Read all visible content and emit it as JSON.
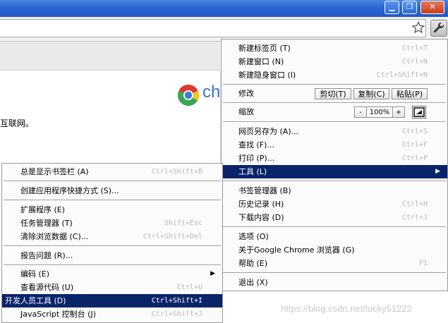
{
  "window": {
    "minimize_glyph": "▁",
    "restore_glyph": "❐",
    "close_glyph": "✕"
  },
  "toolbar": {
    "star_icon": "star-icon",
    "wrench_icon": "wrench-icon"
  },
  "page": {
    "logo_text": "ch",
    "text": "互联网。"
  },
  "main_menu": {
    "new_tab": {
      "label": "新建标签页 (T)",
      "shortcut": "Ctrl+T"
    },
    "new_window": {
      "label": "新建窗口 (N)",
      "shortcut": "Ctrl+N"
    },
    "new_incognito": {
      "label": "新建隐身窗口 (I)",
      "shortcut": "Ctrl+Shift+N"
    },
    "edit_label": "修改",
    "cut": "剪切(T)",
    "copy": "复制(C)",
    "paste": "粘贴(P)",
    "zoom_label": "缩放",
    "zoom_out": "-",
    "zoom_value": "100%",
    "zoom_in": "+",
    "save_as": {
      "label": "网页另存为 (A)...",
      "shortcut": "Ctrl+S"
    },
    "find": {
      "label": "查找 (F)...",
      "shortcut": "Ctrl+F"
    },
    "print": {
      "label": "打印 (P)...",
      "shortcut": "Ctrl+P"
    },
    "tools": {
      "label": "工具 (L)",
      "arrow": "▶"
    },
    "bookmark_manager": {
      "label": "书签管理器 (B)",
      "shortcut": ""
    },
    "history": {
      "label": "历史记录 (H)",
      "shortcut": "Ctrl+H"
    },
    "downloads": {
      "label": "下载内容 (D)",
      "shortcut": "Ctrl+J"
    },
    "options": {
      "label": "选项 (O)",
      "shortcut": ""
    },
    "about": {
      "label": "关于Google Chrome 浏览器 (G)",
      "shortcut": ""
    },
    "help": {
      "label": "帮助 (E)",
      "shortcut": "F1"
    },
    "exit": {
      "label": "退出 (X)",
      "shortcut": ""
    }
  },
  "tools_menu": {
    "show_bookmarks_bar": {
      "label": "总是显示书签栏 (A)",
      "shortcut": "Ctrl+Shift+B"
    },
    "create_shortcuts": {
      "label": "创建应用程序快捷方式 (S)...",
      "shortcut": ""
    },
    "extensions": {
      "label": "扩展程序 (E)",
      "shortcut": ""
    },
    "task_manager": {
      "label": "任务管理器 (T)",
      "shortcut": "Shift+Esc"
    },
    "clear_data": {
      "label": "清除浏览数据 (C)...",
      "shortcut": "Ctrl+Shift+Del"
    },
    "report_issue": {
      "label": "报告问题 (R)...",
      "shortcut": ""
    },
    "encoding": {
      "label": "编码 (E)",
      "arrow": "▶"
    },
    "view_source": {
      "label": "查看源代码 (U)",
      "shortcut": "Ctrl+U"
    },
    "developer_tools": {
      "label": "开发人员工具 (D)",
      "shortcut": "Ctrl+Shift+I"
    },
    "js_console": {
      "label": "JavaScript 控制台 (J)",
      "shortcut": "Ctrl+Shift+J"
    }
  },
  "watermark": "https://blog.csdn.net/lucky51222",
  "colors": {
    "highlight": "#0a246a",
    "titlebar": "#2a67d2"
  }
}
